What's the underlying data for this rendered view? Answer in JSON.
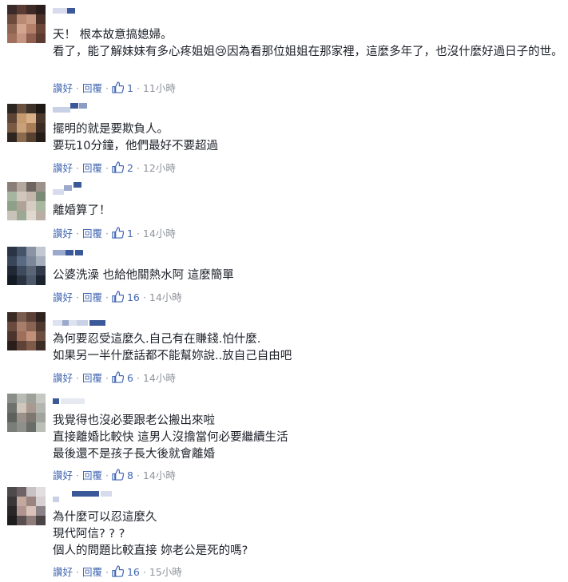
{
  "labels": {
    "like": "讚好",
    "reply": "回覆",
    "dot": "·"
  },
  "colors": {
    "link": "#4267b2",
    "meta": "#90949c",
    "text": "#1d2129"
  },
  "comments": [
    {
      "lines": [
        "天！ 根本故意搞媳婦。",
        "看了，能了解妹妹有多心疼姐姐😢因為看那位姐姐在那家裡，這麼多年了，也沒什麼好過日子的世。"
      ],
      "likes": "1",
      "time": "11小時"
    },
    {
      "lines": [
        "擺明的就是要欺負人。",
        "要玩10分鐘，他們最好不要超過"
      ],
      "likes": "2",
      "time": "12小時"
    },
    {
      "lines": [
        "離婚算了！"
      ],
      "likes": "1",
      "time": "14小時"
    },
    {
      "lines": [
        "公婆洗澡 也給他關熱水阿 這麼簡單"
      ],
      "likes": "16",
      "time": "14小時"
    },
    {
      "lines": [
        "為何要忍受這麼久.自己有在賺錢.怕什麼.",
        "如果另一半什麼話都不能幫妳說..放自己自由吧"
      ],
      "likes": "6",
      "time": "14小時"
    },
    {
      "lines": [
        "我覺得也沒必要跟老公搬出來啦",
        "直接離婚比較快 這男人沒擔當何必要繼續生活",
        "最後還不是孩子長大後就會離婚"
      ],
      "likes": "8",
      "time": "14小時"
    },
    {
      "lines": [
        "為什麼可以忍這麼久",
        "現代阿信? ? ?",
        "個人的問題比較直接 妳老公是死的嗎?"
      ],
      "likes": "16",
      "time": "15小時"
    }
  ]
}
